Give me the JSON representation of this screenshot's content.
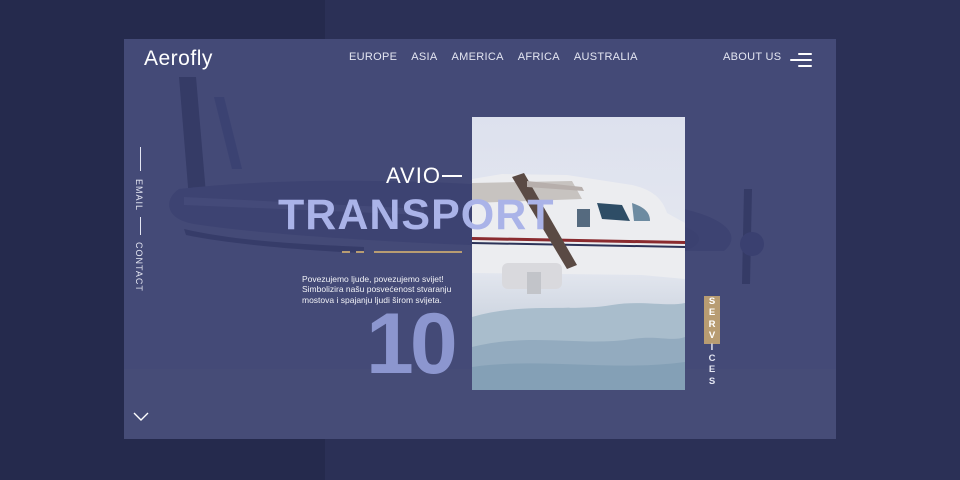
{
  "brand": {
    "logo": "Aerofly"
  },
  "nav": {
    "items": [
      "EUROPE",
      "ASIA",
      "AMERICA",
      "AFRICA",
      "AUSTRALIA"
    ],
    "about": "ABOUT US"
  },
  "side": {
    "email": "EMAIL",
    "contact": "CONTACT"
  },
  "hero": {
    "kicker": "AVIO",
    "title": "TRANSPORT",
    "description": "Povezujemo ljude, povezujemo svijet! Simbolizira našu posvećenost stvaranju mostova i spajanju ljudi širom svijeta.",
    "number": "10",
    "services_letters": [
      "S",
      "E",
      "R",
      "V",
      "I",
      "C",
      "E",
      "S"
    ]
  },
  "colors": {
    "background": "#252a4d",
    "card": "#444a77",
    "accent": "#b89c72",
    "title": "#aab3e8",
    "number": "#8c96cf"
  },
  "icons": {
    "menu": "hamburger-menu-icon",
    "scroll": "chevron-down-icon"
  }
}
